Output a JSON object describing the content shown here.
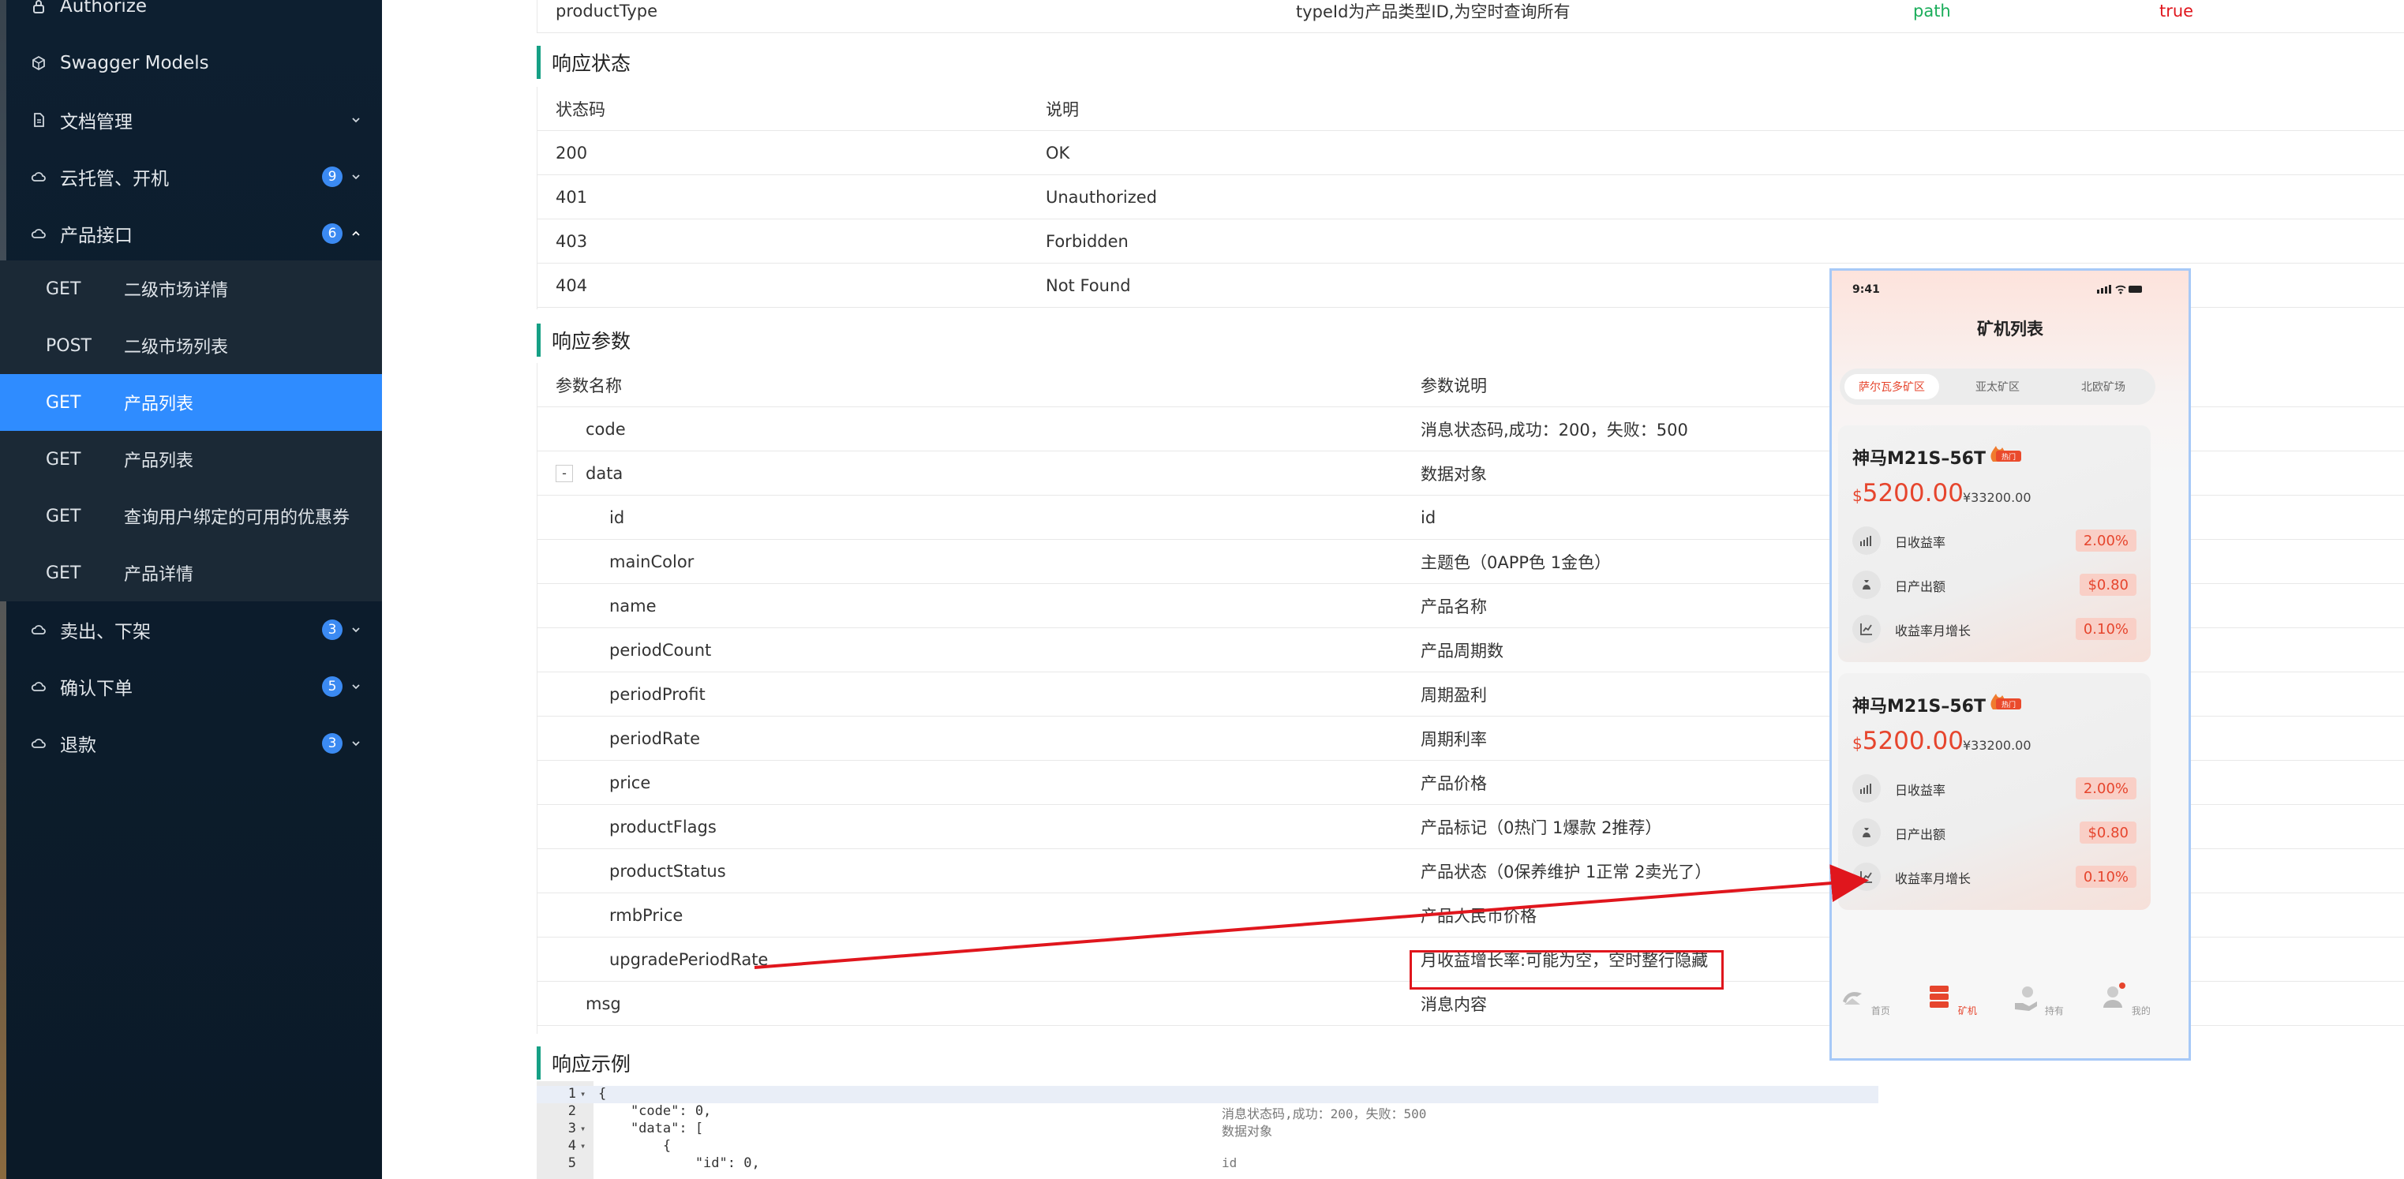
{
  "sidebar": {
    "items": [
      {
        "label": "Authorize"
      },
      {
        "label": "Swagger Models"
      },
      {
        "label": "文档管理"
      },
      {
        "label": "云托管、开机",
        "badge": "9"
      },
      {
        "label": "产品接口",
        "badge": "6"
      },
      {
        "label": "卖出、下架",
        "badge": "3"
      },
      {
        "label": "确认下单",
        "badge": "5"
      },
      {
        "label": "退款",
        "badge": "3"
      }
    ],
    "sub_items": [
      {
        "method": "GET",
        "title": "二级市场详情"
      },
      {
        "method": "POST",
        "title": "二级市场列表"
      },
      {
        "method": "GET",
        "title": "产品列表"
      },
      {
        "method": "GET",
        "title": "产品列表"
      },
      {
        "method": "GET",
        "title": "查询用户绑定的可用的优惠券"
      },
      {
        "method": "GET",
        "title": "产品详情"
      }
    ]
  },
  "param_row": {
    "name": "productType",
    "desc": "typeId为产品类型ID,为空时查询所有",
    "in": "path",
    "required": "true"
  },
  "status_section": {
    "title": "响应状态",
    "headers": [
      "状态码",
      "说明"
    ],
    "rows": [
      {
        "code": "200",
        "desc": "OK"
      },
      {
        "code": "401",
        "desc": "Unauthorized"
      },
      {
        "code": "403",
        "desc": "Forbidden"
      },
      {
        "code": "404",
        "desc": "Not Found"
      }
    ]
  },
  "response_section": {
    "title": "响应参数",
    "headers": [
      "参数名称",
      "参数说明"
    ],
    "toggle": "-",
    "rows": [
      {
        "name": "code",
        "desc": "消息状态码,成功：200，失败：500"
      },
      {
        "name": "data",
        "desc": "数据对象"
      },
      {
        "name": "id",
        "desc": "id"
      },
      {
        "name": "mainColor",
        "desc": "主题色（0APP色 1金色）"
      },
      {
        "name": "name",
        "desc": "产品名称"
      },
      {
        "name": "periodCount",
        "desc": "产品周期数"
      },
      {
        "name": "periodProfit",
        "desc": "周期盈利"
      },
      {
        "name": "periodRate",
        "desc": "周期利率"
      },
      {
        "name": "price",
        "desc": "产品价格"
      },
      {
        "name": "productFlags",
        "desc": "产品标记（0热门 1爆款 2推荐）"
      },
      {
        "name": "productStatus",
        "desc": "产品状态（0保养维护 1正常 2卖光了）"
      },
      {
        "name": "rmbPrice",
        "desc": "产品人民币价格"
      },
      {
        "name": "upgradePeriodRate",
        "desc": "月收益增长率:可能为空，空时整行隐藏"
      },
      {
        "name": "msg",
        "desc": "消息内容"
      }
    ]
  },
  "example_section": {
    "title": "响应示例",
    "lines": [
      {
        "n": "1",
        "fold": "▾",
        "text": "{",
        "comment": ""
      },
      {
        "n": "2",
        "fold": "",
        "text": "    \"code\": 0,",
        "comment": "消息状态码,成功：200，失败：500"
      },
      {
        "n": "3",
        "fold": "▾",
        "text": "    \"data\": [",
        "comment": "数据对象"
      },
      {
        "n": "4",
        "fold": "▾",
        "text": "        {",
        "comment": ""
      },
      {
        "n": "5",
        "fold": "",
        "text": "            \"id\": 0,",
        "comment": "id"
      }
    ]
  },
  "phone": {
    "time": "9:41",
    "title": "矿机列表",
    "tabs": [
      "萨尔瓦多矿区",
      "亚太矿区",
      "北欧矿场"
    ],
    "hot_badge": "热门",
    "cards": [
      {
        "name": "神马M21S–56T",
        "currency": "$",
        "price": "5200.00",
        "orig_price": "¥33200.00",
        "stats": [
          {
            "label": "日收益率",
            "value": "2.00%"
          },
          {
            "label": "日产出额",
            "value": "$0.80"
          },
          {
            "label": "收益率月增长",
            "value": "0.10%"
          }
        ]
      },
      {
        "name": "神马M21S–56T",
        "currency": "$",
        "price": "5200.00",
        "orig_price": "¥33200.00",
        "stats": [
          {
            "label": "日收益率",
            "value": "2.00%"
          },
          {
            "label": "日产出额",
            "value": "$0.80"
          },
          {
            "label": "收益率月增长",
            "value": "0.10%"
          }
        ]
      }
    ],
    "nav": [
      "首页",
      "矿机",
      "持有",
      "我的"
    ]
  },
  "colors": {
    "accent": "#2f8cff",
    "sidebar": "#0d1f30",
    "section_bar": "#16a085",
    "annotation": "#e0161d",
    "path": "#1aad5a",
    "required": "#e0161d",
    "phone_accent": "#e6452d"
  }
}
